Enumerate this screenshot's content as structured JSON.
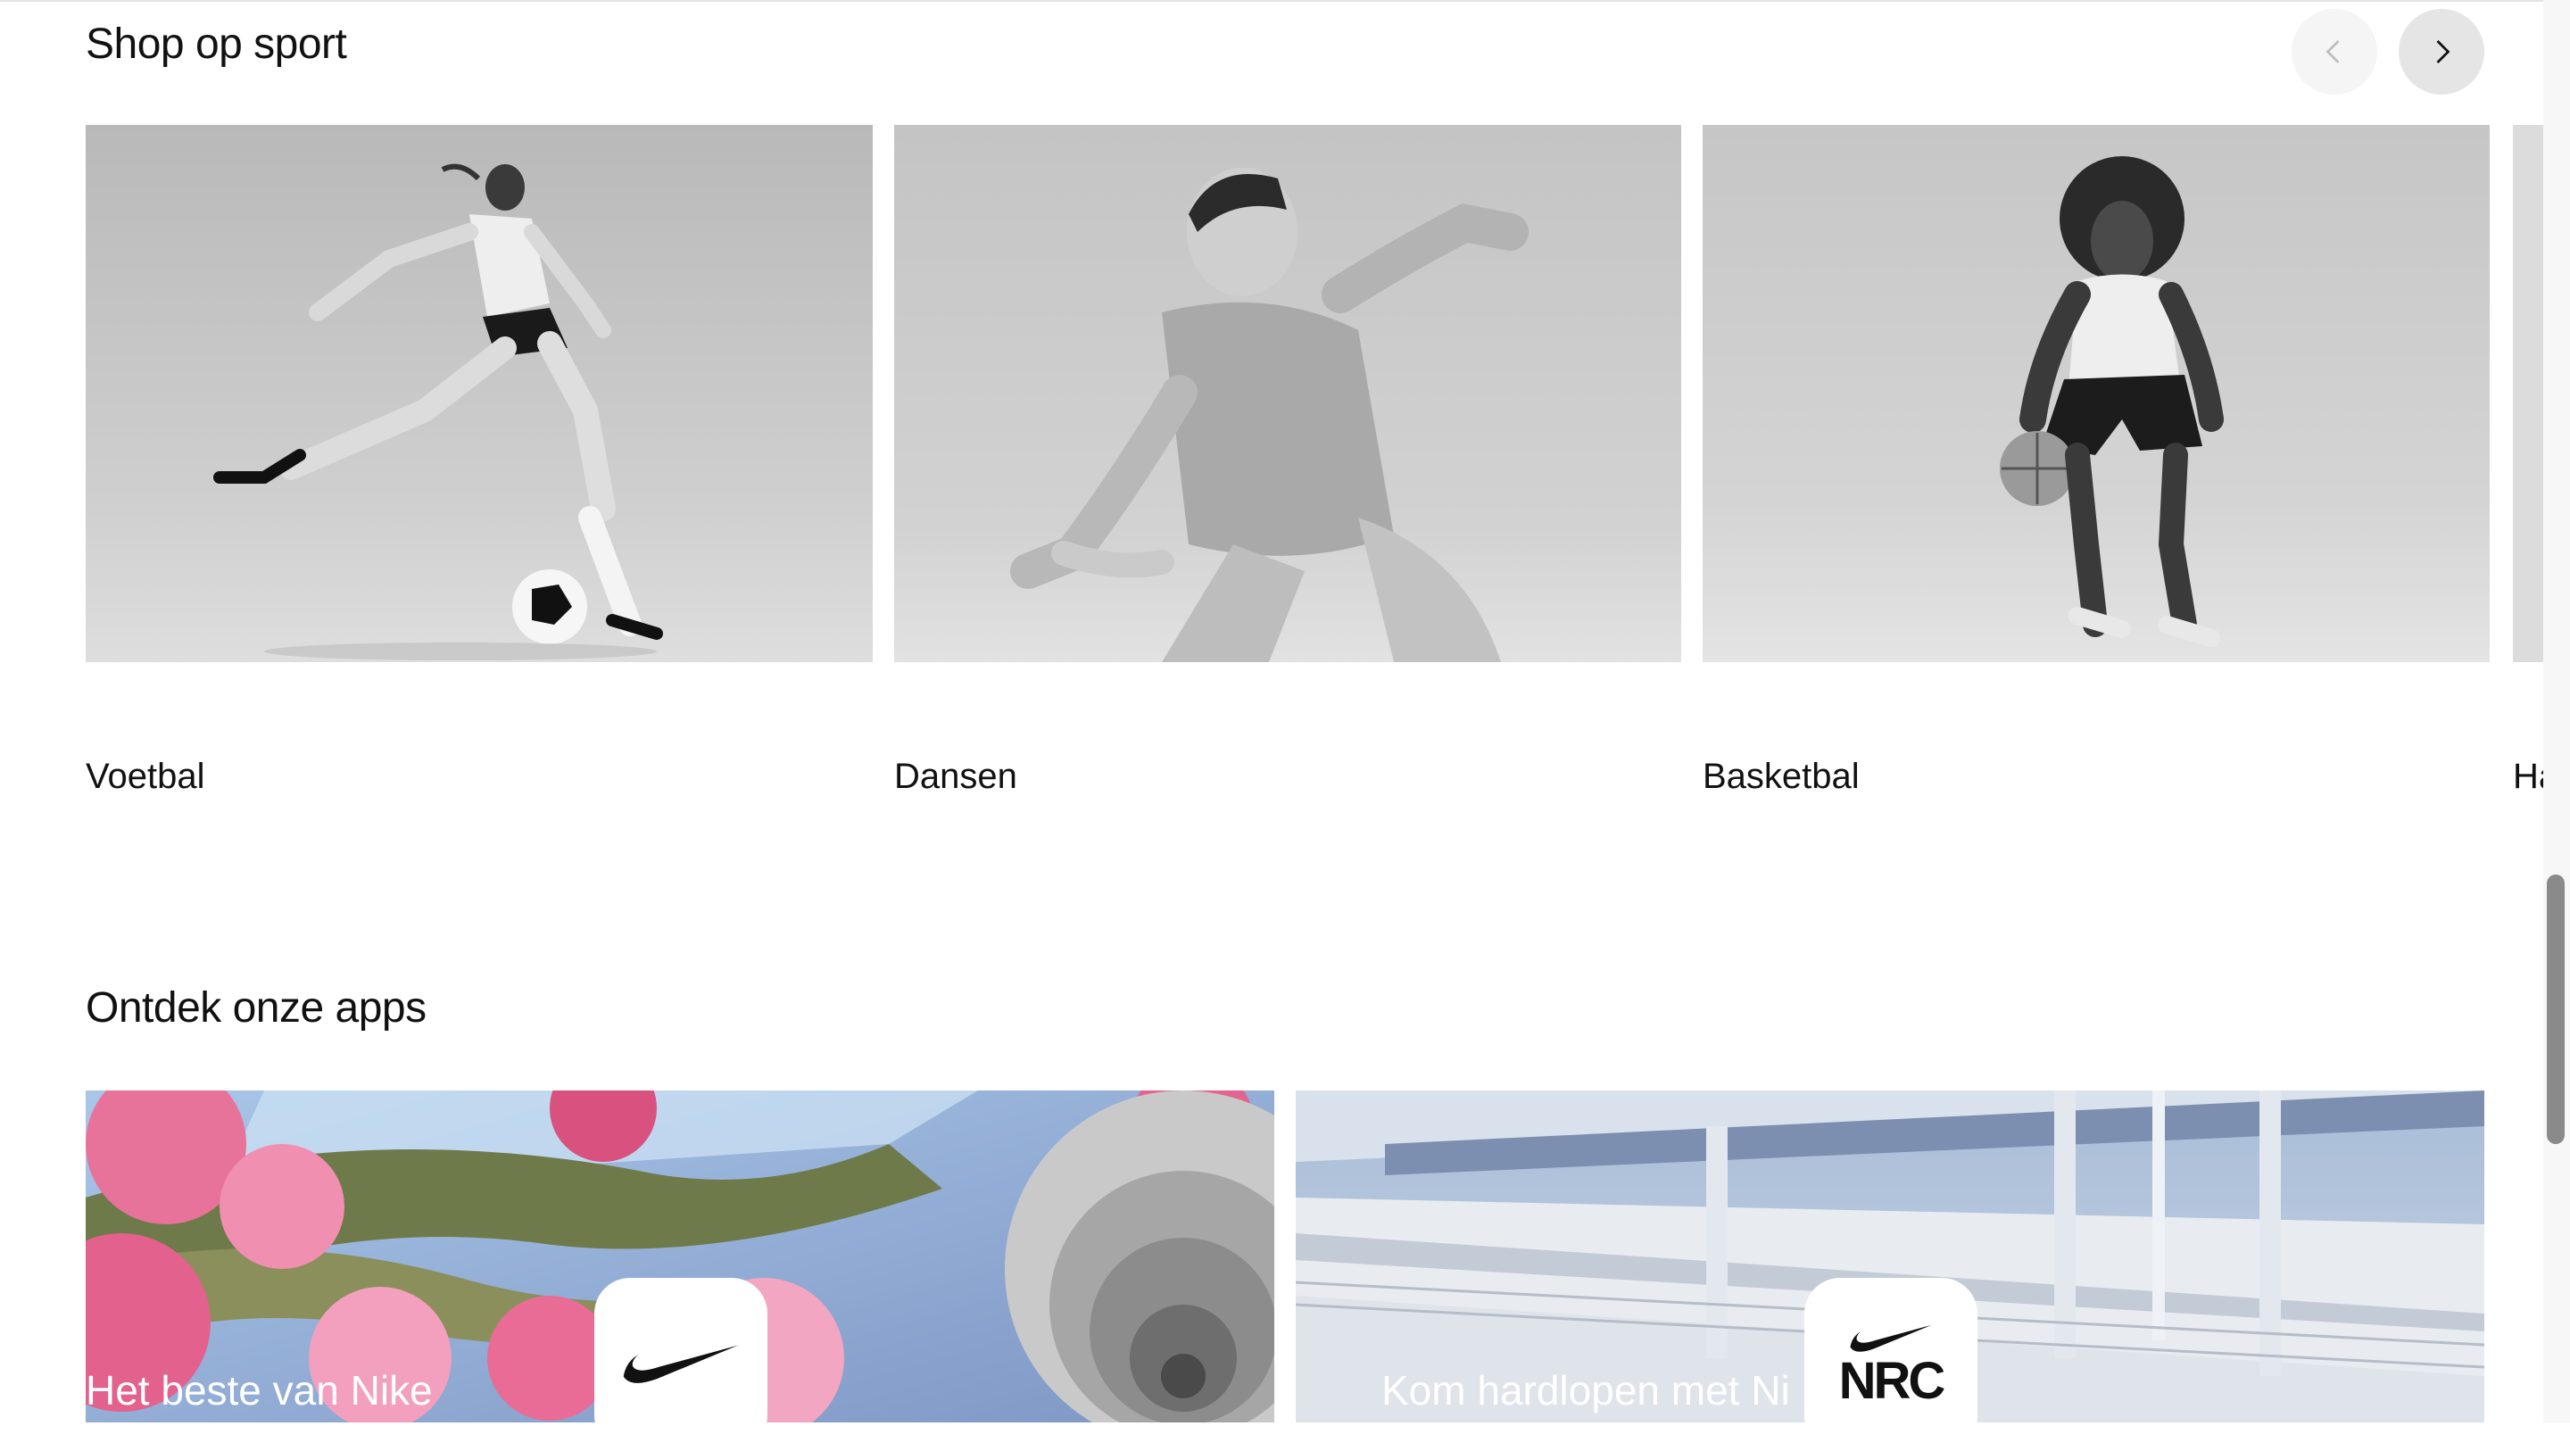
{
  "sport_section": {
    "title": "Shop op sport",
    "cards": [
      {
        "label": "Voetbal"
      },
      {
        "label": "Dansen"
      },
      {
        "label": "Basketbal"
      },
      {
        "label": "Har"
      }
    ]
  },
  "apps_section": {
    "title": "Ontdek onze apps",
    "cards": [
      {
        "text": "Het beste van Nike",
        "icon": "nike-swoosh-icon"
      },
      {
        "text": "Kom hardlopen met Ni",
        "icon": "nrc-app-icon",
        "icon_text": "NRC"
      }
    ]
  },
  "icons": {
    "prev": "chevron-left-icon",
    "next": "chevron-right-icon"
  }
}
